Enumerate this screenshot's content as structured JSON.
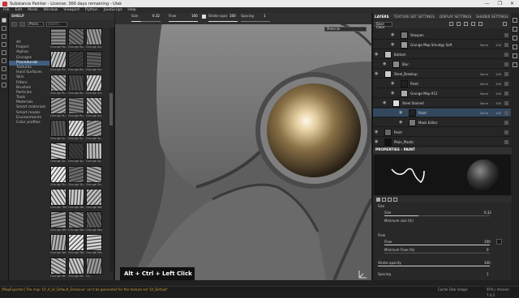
{
  "window": {
    "title": "Substance Painter - License: 366 days remaining - Ulak",
    "controls": [
      "—",
      "❐",
      "✕"
    ]
  },
  "menu": [
    "File",
    "Edit",
    "Mode",
    "Window",
    "Viewport",
    "Python",
    "JavaScript",
    "Help"
  ],
  "shelf": {
    "title": "SHELF",
    "filter_value": "Proce...",
    "search_placeholder": "Search...",
    "categories": [
      "All",
      "Project",
      "Alphas",
      "Grunges",
      "Procedurals",
      "Textures",
      "Hard Surfaces",
      "Skin",
      "Filters",
      "Brushes",
      "Particles",
      "Tools",
      "Materials",
      "Smart materials",
      "Smart masks",
      "Environments",
      "Color profiles"
    ],
    "active_category": "Procedurals",
    "thumbs": [
      {
        "label": "Grunge Ro...",
        "tone": "#8a8a8a"
      },
      {
        "label": "Grunge Ro...",
        "tone": "#6e6e6e"
      },
      {
        "label": "Grunge Scr...",
        "tone": "#9a9a9a"
      },
      {
        "label": "Grunge Ro...",
        "tone": "#c4c4c4"
      },
      {
        "label": "Grunge Ro...",
        "tone": "#3c3c3c"
      },
      {
        "label": "Grunge Scr...",
        "tone": "#5a5a5a"
      },
      {
        "label": "Grunge Ru...",
        "tone": "#aaaaaa"
      },
      {
        "label": "Grunge Ru...",
        "tone": "#4a4a4a"
      },
      {
        "label": "Grunge Scr...",
        "tone": "#d0d0d0"
      },
      {
        "label": "Grunge Ru...",
        "tone": "#9e9e9e"
      },
      {
        "label": "Grunge Ru...",
        "tone": "#7d7d7d"
      },
      {
        "label": "Grunge Scr...",
        "tone": "#b8b8b8"
      },
      {
        "label": "Grunge Sc...",
        "tone": "#555555"
      },
      {
        "label": "Grunge Sc...",
        "tone": "#e0e0e0"
      },
      {
        "label": "Grunge Sp...",
        "tone": "#9a9a9a"
      },
      {
        "label": "Grunge Sp...",
        "tone": "#cfcfcf"
      },
      {
        "label": "Grunge Sp...",
        "tone": "#3a3a3a"
      },
      {
        "label": "Grunge Sp...",
        "tone": "#bdbdbd"
      },
      {
        "label": "Grunge Str...",
        "tone": "#ededed"
      },
      {
        "label": "Grunge Str...",
        "tone": "#6b6b6b"
      },
      {
        "label": "Grunge Str...",
        "tone": "#a5a5a5"
      },
      {
        "label": "Grunge Tile...",
        "tone": "#d8d8d8"
      },
      {
        "label": "Grunge Wa...",
        "tone": "#cccccc"
      },
      {
        "label": "Grunge Wa...",
        "tone": "#bfbfbf"
      },
      {
        "label": "Grunge We...",
        "tone": "#a0a0a0"
      },
      {
        "label": "Grunge Wo...",
        "tone": "#8c8c8c"
      },
      {
        "label": "Grunge Wo...",
        "tone": "#5c5c5c"
      },
      {
        "label": "Grunge Wo...",
        "tone": "#b0b0b0"
      },
      {
        "label": "Grunge Wo...",
        "tone": "#e6e6e6"
      },
      {
        "label": "Grunge Wo...",
        "tone": "#d4d4d4"
      },
      {
        "label": "Grunge Wr...",
        "tone": "#bcbcbc"
      },
      {
        "label": "Grunge Wr...",
        "tone": "#c8c8c8"
      },
      {
        "label": "Gr...",
        "tone": "#9a9a9a"
      }
    ]
  },
  "viewport": {
    "toolbar": {
      "size_label": "Size",
      "size_value": "0.32",
      "flow_label": "Flow",
      "flow_value": "100",
      "stroke_opacity_label": "Stroke opac",
      "stroke_opacity_value": "100",
      "spacing_label": "Spacing",
      "spacing_value": "1"
    },
    "material_select": "Material",
    "hint": "Alt + Ctrl + Left Click"
  },
  "layers": {
    "tabs": [
      "LAYERS",
      "TEXTURE SET SETTINGS",
      "DISPLAY SETTINGS",
      "SHADER SETTINGS"
    ],
    "active_tab": "LAYERS",
    "channel": "Base Color",
    "rows": [
      {
        "name": "Sharpen",
        "blend": "",
        "opacity": "",
        "indent": 34,
        "tone": "#777",
        "sel": false
      },
      {
        "name": "Grunge Map Smudgy Soft",
        "blend": "Norm",
        "opacity": "100",
        "indent": 34,
        "tone": "#999",
        "sel": false
      },
      {
        "name": "Bottom",
        "blend": "",
        "opacity": "",
        "indent": 14,
        "tone": "#bbb",
        "sel": false
      },
      {
        "name": "Blur",
        "blend": "",
        "opacity": "",
        "indent": 24,
        "tone": "#888",
        "sel": false
      },
      {
        "name": "Steel_Breakup",
        "blend": "Norm",
        "opacity": "100",
        "indent": 14,
        "tone": "#ccc",
        "sel": false
      },
      {
        "name": "Paint",
        "blend": "Norm",
        "opacity": "100",
        "indent": 34,
        "tone": "#222",
        "sel": false
      },
      {
        "name": "Grunge Map 012",
        "blend": "Norm",
        "opacity": "100",
        "indent": 34,
        "tone": "#aaa",
        "sel": false
      },
      {
        "name": "Steel Stained",
        "blend": "Norm",
        "opacity": "100",
        "indent": 24,
        "tone": "#ddd",
        "sel": false
      },
      {
        "name": "Paint",
        "blend": "Norm",
        "opacity": "100",
        "indent": 44,
        "tone": "#222",
        "sel": true
      },
      {
        "name": "Mask Editor",
        "blend": "",
        "opacity": "",
        "indent": 44,
        "tone": "#777",
        "sel": false
      },
      {
        "name": "Paint",
        "blend": "",
        "opacity": "",
        "indent": 14,
        "tone": "#666",
        "sel": false
      },
      {
        "name": "Plain_Plastic",
        "blend": "",
        "opacity": "",
        "indent": 14,
        "tone": "#111",
        "sel": false
      }
    ]
  },
  "properties": {
    "title": "PROPERTIES - PAINT",
    "sections": {
      "size_section": "Size",
      "size_label": "Size",
      "size_value": "0.32",
      "minsize_label": "Minimum size (%)",
      "flow_section": "Flow",
      "flow_label": "Flow",
      "flow_value": "100",
      "minflow_label": "Minimum Flow (%)",
      "minflow_value": "0",
      "stroke_label": "Stroke opacity",
      "stroke_value": "100",
      "spacing_label": "Spacing",
      "spacing_value": "1"
    },
    "levels": {
      "size": 0.32,
      "flow": 1.0,
      "minflow": 0.0,
      "stroke": 1.0
    }
  },
  "status": {
    "message": "[MapExporter] The map 'LP_A_LV_Default_Emissive' can't be generated for the texture set 'LV_Default'",
    "cache": "Cache Disk Usage:",
    "version": "95% | Version: 7.4.2"
  }
}
